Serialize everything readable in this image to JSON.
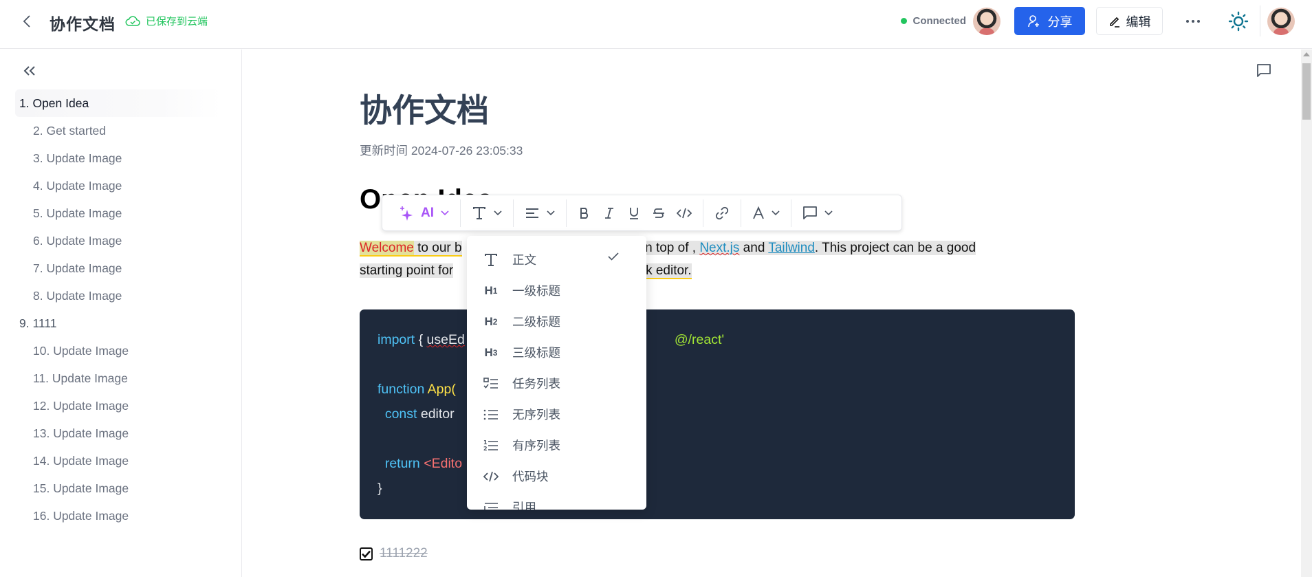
{
  "header": {
    "title": "协作文档",
    "saved_status": "已保存到云端",
    "connection_status": "Connected",
    "share_label": "分享",
    "edit_label": "编辑",
    "colors": {
      "accent": "#2563eb",
      "saved": "#22c55e",
      "connected": "#22c55e",
      "theme_icon": "#0e7490"
    }
  },
  "sidebar": {
    "toc": [
      {
        "label": "1. Open Idea",
        "level": 1,
        "active": true
      },
      {
        "label": "2. Get started",
        "level": 2
      },
      {
        "label": "3. Update Image",
        "level": 2
      },
      {
        "label": "4. Update Image",
        "level": 2
      },
      {
        "label": "5. Update Image",
        "level": 2
      },
      {
        "label": "6. Update Image",
        "level": 2
      },
      {
        "label": "7. Update Image",
        "level": 2
      },
      {
        "label": "8. Update Image",
        "level": 2
      },
      {
        "label": "9. 1111",
        "level": 1
      },
      {
        "label": "10. Update Image",
        "level": 2
      },
      {
        "label": "11. Update Image",
        "level": 2
      },
      {
        "label": "12. Update Image",
        "level": 2
      },
      {
        "label": "13. Update Image",
        "level": 2
      },
      {
        "label": "14. Update Image",
        "level": 2
      },
      {
        "label": "15. Update Image",
        "level": 2
      },
      {
        "label": "16. Update Image",
        "level": 2
      }
    ]
  },
  "document": {
    "title": "协作文档",
    "updated_label": "更新时间 2024-07-26 23:05:33",
    "heading": "Open Idea",
    "paragraph": {
      "welcome": "Welcome",
      "part1": " to our b",
      "part1_tail": "e built on top of , ",
      "link1": "Next.js",
      "and": " and ",
      "link2": "Tailwind",
      "part2": ". This project can be a good ",
      "line2_start": "starting point for",
      "line2_end": "of a block editor."
    },
    "code": {
      "line1": {
        "kw": "import",
        "rest": " { ",
        "spell": "useEd",
        "tail": "@/react'"
      },
      "line3": {
        "kw": "function",
        "fn": " App("
      },
      "line4": {
        "kw": "  const",
        "rest": " editor"
      },
      "line6": {
        "kw": "  return",
        "tag": " <Edito"
      },
      "line7": "}"
    },
    "task": {
      "text": "1111222",
      "checked": true
    }
  },
  "toolbar": {
    "ai_label": "AI",
    "items": [
      "ai",
      "text-style",
      "align",
      "bold",
      "italic",
      "underline",
      "strikethrough",
      "inline-code",
      "link",
      "text-color",
      "comment"
    ]
  },
  "block_menu": {
    "items": [
      {
        "icon": "T",
        "label": "正文",
        "selected": true
      },
      {
        "icon": "H1",
        "label": "一级标题"
      },
      {
        "icon": "H2",
        "label": "二级标题"
      },
      {
        "icon": "H3",
        "label": "三级标题"
      },
      {
        "icon": "task-list",
        "label": "任务列表"
      },
      {
        "icon": "bullet-list",
        "label": "无序列表"
      },
      {
        "icon": "ordered-list",
        "label": "有序列表"
      },
      {
        "icon": "code",
        "label": "代码块"
      },
      {
        "icon": "quote",
        "label": "引用"
      }
    ]
  }
}
